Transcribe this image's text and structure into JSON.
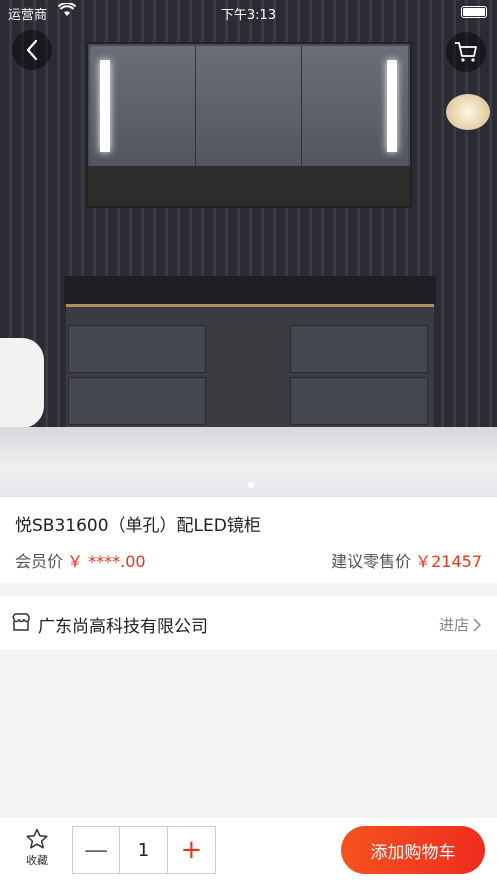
{
  "status_bar": {
    "carrier": "运营商",
    "time": "下午3:13"
  },
  "product": {
    "title": "悦SB31600（单孔）配LED镜柜",
    "member_price_label": "会员价",
    "member_price": "￥ ****.00",
    "suggested_price_label": "建议零售价",
    "suggested_price": "￥21457"
  },
  "store": {
    "name": "广东尚高科技有限公司",
    "enter_label": "进店"
  },
  "bottom_bar": {
    "favorite_label": "收藏",
    "quantity": "1",
    "minus_symbol": "—",
    "plus_symbol": "+",
    "add_to_cart_label": "添加购物车"
  },
  "colors": {
    "accent": "#e8351d",
    "button_gradient_start": "#f5531f",
    "button_gradient_end": "#ef2c1e"
  },
  "icons": [
    "back-icon",
    "cart-icon",
    "wifi-icon",
    "battery-icon",
    "store-icon",
    "chevron-right-icon",
    "star-icon"
  ],
  "gallery": {
    "page_count": 1,
    "current_page": 1
  }
}
